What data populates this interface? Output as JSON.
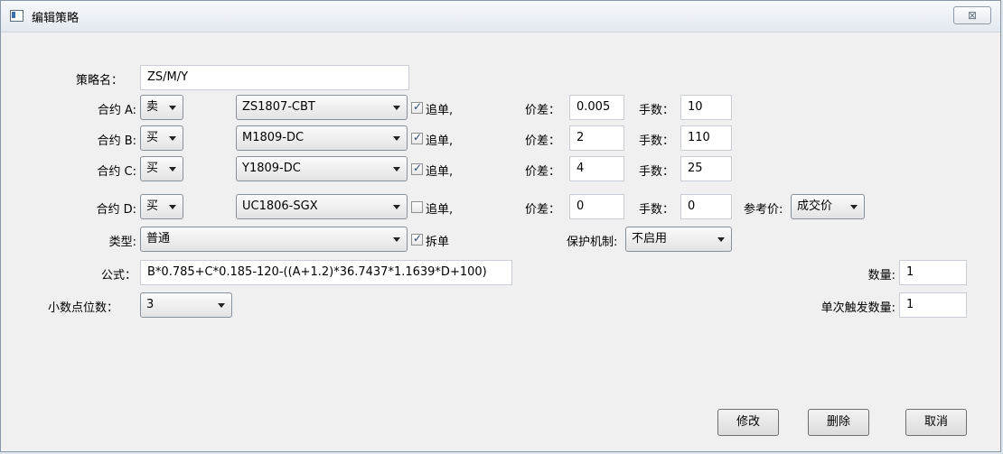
{
  "window": {
    "title": "编辑策略",
    "close_label": "⊠"
  },
  "form": {
    "name_label": "策略名：",
    "name_value": "ZS/M/Y",
    "contracts": [
      {
        "label": "合约 A:",
        "direction": "卖",
        "instrument": "ZS1807-CBT",
        "chase_checked": true,
        "chase_label": "追单,",
        "spread_label": "价差：",
        "spread": "0.005",
        "qty_label": "手数：",
        "qty": "10"
      },
      {
        "label": "合约 B:",
        "direction": "买",
        "instrument": "M1809-DC",
        "chase_checked": true,
        "chase_label": "追单,",
        "spread_label": "价差：",
        "spread": "2",
        "qty_label": "手数：",
        "qty": "110"
      },
      {
        "label": "合约 C:",
        "direction": "买",
        "instrument": "Y1809-DC",
        "chase_checked": true,
        "chase_label": "追单,",
        "spread_label": "价差：",
        "spread": "4",
        "qty_label": "手数：",
        "qty": "25"
      },
      {
        "label": "合约 D:",
        "direction": "买",
        "instrument": "UC1806-SGX",
        "chase_checked": false,
        "chase_label": "追单,",
        "spread_label": "价差：",
        "spread": "0",
        "qty_label": "手数：",
        "qty": "0"
      }
    ],
    "ref_price_label": "参考价:",
    "ref_price": "成交价",
    "type_label": "类型:",
    "type_value": "普通",
    "split_checked": true,
    "split_label": "拆单",
    "protect_label": "保护机制:",
    "protect_value": "不启用",
    "formula_label": "公式：",
    "formula_value": "B*0.785+C*0.185-120-((A+1.2)*36.7437*1.1639*D+100)",
    "quantity_label": "数量:",
    "quantity_value": "1",
    "decimals_label": "小数点位数：",
    "decimals_value": "3",
    "trigger_label": "单次触发数量:",
    "trigger_value": "1"
  },
  "buttons": {
    "modify": "修改",
    "delete": "删除",
    "cancel": "取消"
  }
}
